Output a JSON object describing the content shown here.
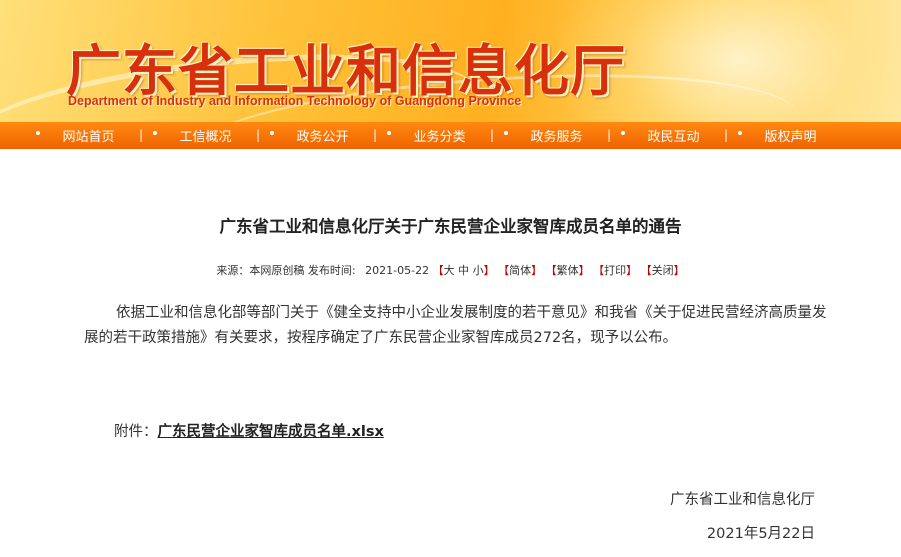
{
  "banner": {
    "title": "广东省工业和信息化厅",
    "subtitle": "Department of Industry and Information Technology of Guangdong Province"
  },
  "nav": {
    "items": [
      {
        "label": "网站首页"
      },
      {
        "label": "工信概况"
      },
      {
        "label": "政务公开"
      },
      {
        "label": "业务分类"
      },
      {
        "label": "政务服务"
      },
      {
        "label": "政民互动"
      },
      {
        "label": "版权声明"
      }
    ],
    "separator": "|"
  },
  "article": {
    "title": "广东省工业和信息化厅关于广东民营企业家智库成员名单的通告",
    "meta": {
      "source_label": "来源：",
      "source": "本网原创稿",
      "published_label": "发布时间:",
      "published": "2021-05-22",
      "font_sizes": {
        "large": "大",
        "medium": "中",
        "small": "小"
      },
      "simplified": "简体",
      "traditional": "繁体",
      "print": "打印",
      "close": "关闭",
      "open_bracket": "【",
      "close_bracket": "】"
    },
    "body": "依据工业和信息化部等部门关于《健全支持中小企业发展制度的若干意见》和我省《关于促进民营经济高质量发展的若干政策措施》有关要求，按程序确定了广东民营企业家智库成员272名，现予以公布。",
    "attachment_label": "附件：",
    "attachment_link": "广东民营企业家智库成员名单.xlsx",
    "signature": "广东省工业和信息化厅",
    "date": "2021年5月22日"
  },
  "colors": {
    "nav_bg": "#f06200",
    "title_red": "#d8300c",
    "bracket_red": "#c00000"
  }
}
